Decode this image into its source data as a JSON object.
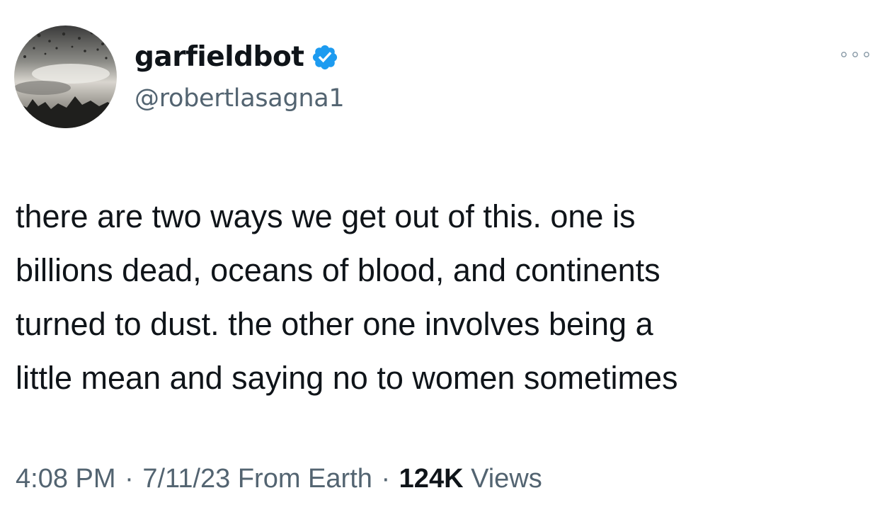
{
  "tweet": {
    "author": {
      "display_name": "garfieldbot",
      "handle": "@robertlasagna1",
      "verified": true,
      "avatar_icon": "avatar-landscape-icon",
      "verified_icon": "verified-badge-icon"
    },
    "more_icon": "more-options-icon",
    "text_lines": [
      "there are two ways we get out of this. one is",
      "billions dead, oceans of blood, and continents",
      "turned to dust. the other one involves being a",
      "little mean and saying no to women sometimes"
    ],
    "meta": {
      "time": "4:08 PM",
      "separator": "·",
      "date": "7/11/23",
      "source": "From Earth",
      "views_count": "124K",
      "views_label": "Views"
    }
  },
  "colors": {
    "text_primary": "#0f1419",
    "text_secondary": "#536471",
    "verified_blue": "#1d9bf0"
  }
}
